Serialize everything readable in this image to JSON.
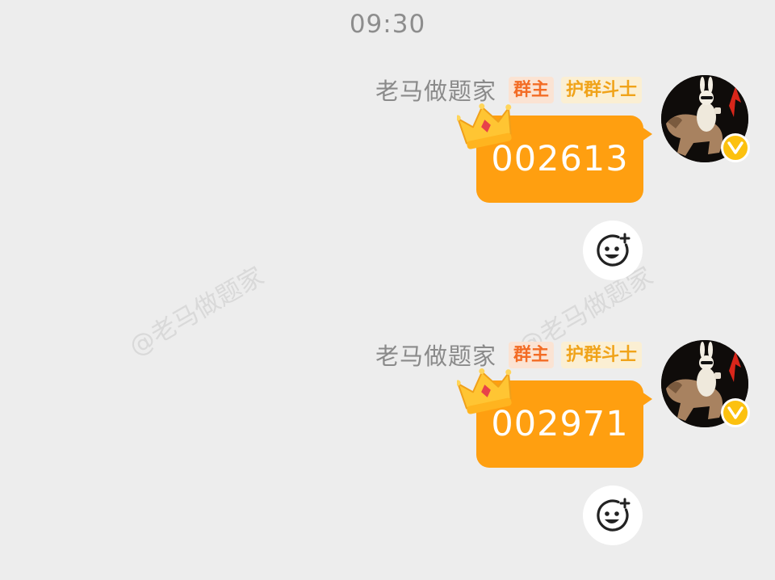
{
  "status": {
    "time": "09:30"
  },
  "watermark": {
    "text": "@老马做题家"
  },
  "messages": [
    {
      "sender": "老马做题家",
      "badges": [
        "群主",
        "护群斗士"
      ],
      "text": "002613"
    },
    {
      "sender": "老马做题家",
      "badges": [
        "群主",
        "护群斗士"
      ],
      "text": "002971"
    }
  ],
  "colors": {
    "background": "#ededed",
    "bubble": "#ff9f10",
    "badge_owner_text": "#f36c25",
    "badge_guard_text": "#f0a31a",
    "verified_badge": "#fcc10f"
  },
  "icons": {
    "avatar": "rabbit-riding-horse-avatar",
    "verified": "verified-v-icon",
    "crown": "crown-icon",
    "react": "add-emoji-reaction-icon"
  }
}
